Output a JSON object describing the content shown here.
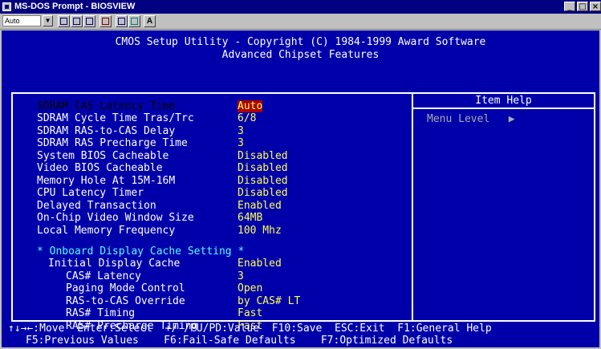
{
  "window": {
    "title": "MS-DOS Prompt - BIOSVIEW",
    "controls": [
      "_",
      "□",
      "×"
    ]
  },
  "toolbar": {
    "font_size": "Auto",
    "buttons": [
      "A"
    ]
  },
  "header": {
    "line1": "CMOS Setup Utility - Copyright (C) 1984-1999 Award Software",
    "line2": "Advanced Chipset Features"
  },
  "settings": [
    {
      "label": "SDRAM CAS Latency Time",
      "value": "Auto"
    },
    {
      "label": "SDRAM Cycle Time Tras/Trc",
      "value": "6/8"
    },
    {
      "label": "SDRAM RAS-to-CAS Delay",
      "value": "3"
    },
    {
      "label": "SDRAM RAS Precharge Time",
      "value": "3"
    },
    {
      "label": "System BIOS Cacheable",
      "value": "Disabled"
    },
    {
      "label": "Video BIOS Cacheable",
      "value": "Disabled"
    },
    {
      "label": "Memory Hole At 15M-16M",
      "value": "Disabled"
    },
    {
      "label": "CPU Latency Timer",
      "value": "Disabled"
    },
    {
      "label": "Delayed Transaction",
      "value": "Enabled"
    },
    {
      "label": "On-Chip Video Window Size",
      "value": "64MB"
    },
    {
      "label": "Local Memory Frequency",
      "value": "100 Mhz"
    }
  ],
  "onboard": {
    "heading": "* Onboard Display Cache Setting *",
    "items": [
      {
        "label": "Initial Display Cache",
        "value": "Enabled"
      },
      {
        "label": "CAS# Latency",
        "value": "3"
      },
      {
        "label": "Paging Mode Control",
        "value": "Open"
      },
      {
        "label": "RAS-to-CAS Override",
        "value": "by CAS# LT"
      },
      {
        "label": "RAS# Timing",
        "value": "Fast"
      },
      {
        "label": "RAS# Precharge Timing",
        "value": "Fast"
      }
    ]
  },
  "help": {
    "title": "Item Help",
    "menu_level": "Menu Level",
    "arrow": "▶"
  },
  "footer": {
    "line1": "↑↓→←:Move  Enter:Select  +/-/PU/PD:Value  F10:Save  ESC:Exit  F1:General Help",
    "line2": "F5:Previous Values    F6:Fail-Safe Defaults    F7:Optimized Defaults"
  },
  "colors": {
    "screen_bg": "#0000aa",
    "label": "#ffffff",
    "value": "#ffff55",
    "highlight_bg": "#aa0000",
    "section": "#55ffff"
  }
}
